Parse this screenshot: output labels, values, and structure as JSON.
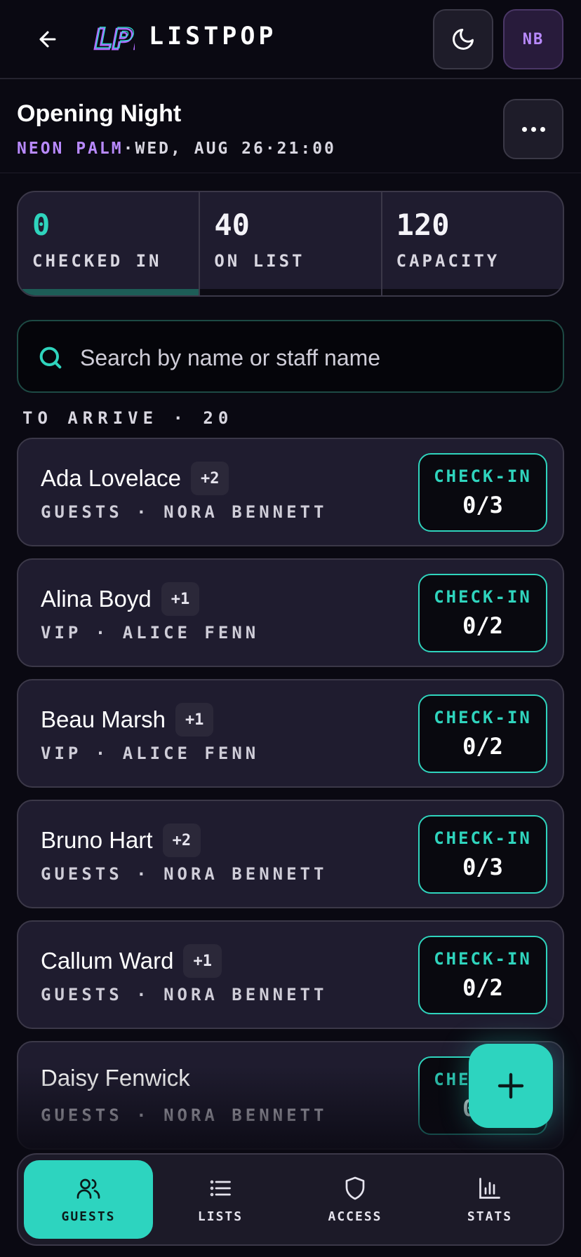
{
  "header": {
    "brand": "LISTPOP",
    "logo_text": "LP!",
    "avatar_initials": "NB"
  },
  "event": {
    "title": "Opening Night",
    "venue": "NEON PALM",
    "separator": " · ",
    "date": "WED, AUG 26",
    "time": "21:00"
  },
  "stats": [
    {
      "value": "0",
      "label": "CHECKED IN",
      "accent": true,
      "progress": 1.0
    },
    {
      "value": "40",
      "label": "ON LIST",
      "accent": false,
      "progress": 0
    },
    {
      "value": "120",
      "label": "CAPACITY",
      "accent": false,
      "progress": 0
    }
  ],
  "search": {
    "placeholder": "Search by name or staff name"
  },
  "section_label": "TO ARRIVE · 20",
  "guests": [
    {
      "name": "Ada Lovelace",
      "plus": "+2",
      "list": "GUESTS",
      "staff": "NORA BENNETT",
      "checkin_label": "CHECK-IN",
      "count": "0/3"
    },
    {
      "name": "Alina Boyd",
      "plus": "+1",
      "list": "VIP",
      "staff": "ALICE FENN",
      "checkin_label": "CHECK-IN",
      "count": "0/2"
    },
    {
      "name": "Beau Marsh",
      "plus": "+1",
      "list": "VIP",
      "staff": "ALICE FENN",
      "checkin_label": "CHECK-IN",
      "count": "0/2"
    },
    {
      "name": "Bruno Hart",
      "plus": "+2",
      "list": "GUESTS",
      "staff": "NORA BENNETT",
      "checkin_label": "CHECK-IN",
      "count": "0/3"
    },
    {
      "name": "Callum Ward",
      "plus": "+1",
      "list": "GUESTS",
      "staff": "NORA BENNETT",
      "checkin_label": "CHECK-IN",
      "count": "0/2"
    },
    {
      "name": "Daisy Fenwick",
      "plus": "",
      "list": "GUESTS",
      "staff": "NORA BENNETT",
      "checkin_label": "CHECK-IN",
      "count": "0/2"
    }
  ],
  "nav": [
    {
      "label": "GUESTS",
      "icon": "users-icon",
      "active": true
    },
    {
      "label": "LISTS",
      "icon": "list-icon",
      "active": false
    },
    {
      "label": "ACCESS",
      "icon": "shield-icon",
      "active": false
    },
    {
      "label": "STATS",
      "icon": "bar-chart-icon",
      "active": false
    }
  ],
  "colors": {
    "accent": "#2dd4bf",
    "venue": "#b98aff",
    "background": "#0a0912",
    "card": "#1f1c2f"
  }
}
